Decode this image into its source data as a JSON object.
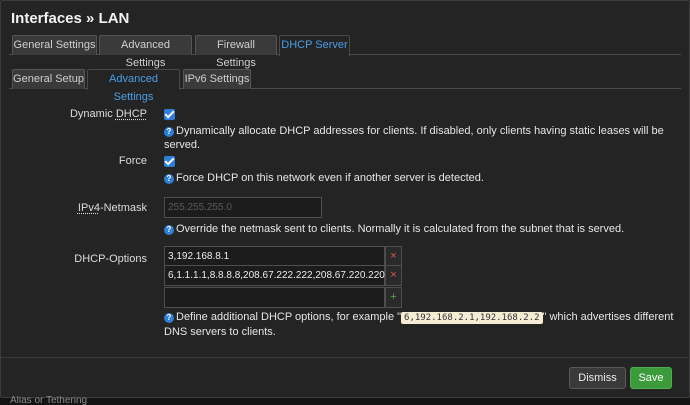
{
  "window": {
    "title": "Interfaces » LAN"
  },
  "tabs_main": [
    {
      "label": "General Settings",
      "active": false
    },
    {
      "label": "Advanced Settings",
      "active": false
    },
    {
      "label": "Firewall Settings",
      "active": false
    },
    {
      "label": "DHCP Server",
      "active": true
    }
  ],
  "tabs_sub": [
    {
      "label": "General Setup",
      "active": false
    },
    {
      "label": "Advanced Settings",
      "active": true
    },
    {
      "label": "IPv6 Settings",
      "active": false
    }
  ],
  "dynamic_dhcp": {
    "label_pre": "Dynamic ",
    "label_u": "DHCP",
    "checked": true,
    "help": "Dynamically allocate DHCP addresses for clients. If disabled, only clients having static leases will be served."
  },
  "force": {
    "label": "Force",
    "checked": true,
    "help": "Force DHCP on this network even if another server is detected."
  },
  "netmask": {
    "label_u": "IPv4",
    "label_post": "-Netmask",
    "placeholder": "255.255.255.0",
    "help": "Override the netmask sent to clients. Normally it is calculated from the subnet that is served."
  },
  "dhcp_options": {
    "label": "DHCP-Options",
    "values": [
      "3,192.168.8.1",
      "6,1.1.1.1,8.8.8.8,208.67.222.222,208.67.220.220"
    ],
    "remove_glyph": "×",
    "add_glyph": "+",
    "help_pre": "Define additional DHCP options, for example \"",
    "help_code": "6,192.168.2.1,192.168.2.2",
    "help_post": "\" which advertises different DNS servers to clients."
  },
  "help_glyph": "?",
  "footer": {
    "dismiss_label": "Dismiss",
    "save_label": "Save"
  },
  "background_text": "Alias or Tethering",
  "colors": {
    "accent": "#2f7fd8",
    "save": "#3b9b3b",
    "remove": "#e05555",
    "add": "#4cae4c"
  }
}
